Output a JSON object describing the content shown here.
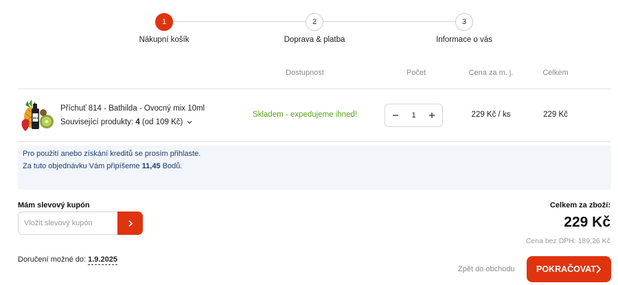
{
  "steps": [
    {
      "number": "1",
      "label": "Nákupní košík",
      "active": true
    },
    {
      "number": "2",
      "label": "Doprava & platba",
      "active": false
    },
    {
      "number": "3",
      "label": "Informace o vás",
      "active": false
    }
  ],
  "table_headers": {
    "availability": "Dostupnost",
    "quantity": "Počet",
    "unit_price": "Cena za m. j.",
    "total": "Celkem"
  },
  "cart_item": {
    "name": "Příchuť 814 - Bathilda - Ovocný mix 10ml",
    "related_label": "Související produkty:",
    "related_count": "4",
    "related_price": "(od 109 Kč)",
    "availability": "Skladem - expedujeme ihned!",
    "quantity": "1",
    "unit_price": "229 Kč / ks",
    "total_price": "229 Kč"
  },
  "credits_info": {
    "line1": "Pro použití anebo získání kreditů se prosím přihlaste.",
    "line2_prefix": "Za tuto objednávku Vám připíšeme",
    "line2_points": "11,45",
    "line2_suffix": "Bodů."
  },
  "coupon": {
    "title": "Mám slevový kupón",
    "placeholder": "Vložit slevový kupón"
  },
  "delivery": {
    "label": "Doručení možné do:",
    "date": "1.9.2025"
  },
  "summary": {
    "label": "Celkem za zboží:",
    "total": "229 Kč",
    "without_vat_label": "Cena bez DPH:",
    "without_vat_value": "189,26 Kč"
  },
  "actions": {
    "back": "Zpět do obchodu",
    "continue": "POKRAČOVAT"
  },
  "colors": {
    "accent": "#e0330f",
    "in_stock": "#5aa51a",
    "info_bg": "#f2f6fb",
    "info_text": "#1e3a6e"
  }
}
